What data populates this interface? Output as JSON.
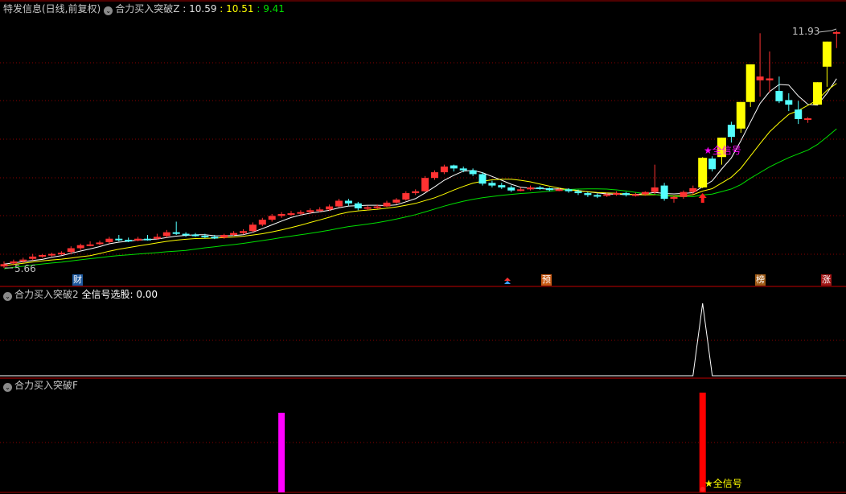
{
  "header": {
    "title": "特发信息(日线,前复权)",
    "indicator": "合力买入突破Z",
    "v1": ": 10.59",
    "v2": ": 10.51",
    "v3": ": 9.41"
  },
  "panel2": {
    "title": "合力买入突破2",
    "label": "全信号选股:",
    "value": "0.00"
  },
  "panel3": {
    "title": "合力买入突破F",
    "signal_label": "★全信号"
  },
  "main_chart": {
    "high_label": "11.93",
    "low_label": "5.66",
    "signal_label": "★全信号",
    "markers": [
      {
        "text": "财",
        "color": "#1e5aa0",
        "index": 7
      },
      {
        "text": "预",
        "color": "#c85a14",
        "index": 56
      },
      {
        "text": "榜",
        "color": "#a05a14",
        "index": 79
      },
      {
        "text": "涨",
        "color": "#a01414",
        "index": 86
      }
    ]
  },
  "colors": {
    "up": "#ff3232",
    "down": "#54ffff",
    "signal": "#ffff00",
    "ma5": "#ffffff",
    "ma10": "#ffff00",
    "ma20": "#00e000",
    "grid": "#8b0000",
    "magenta": "#ff00ff"
  },
  "chart_data": {
    "type": "candlestick",
    "price_range": [
      5.66,
      11.93
    ],
    "signal_candles": [
      73,
      75,
      77,
      78,
      85,
      86
    ],
    "candles_ohlc": [
      [
        5.72,
        5.85,
        5.68,
        5.78
      ],
      [
        5.8,
        5.9,
        5.75,
        5.85
      ],
      [
        5.88,
        5.95,
        5.82,
        5.9
      ],
      [
        5.92,
        6.05,
        5.88,
        5.98
      ],
      [
        6.0,
        6.05,
        5.95,
        6.02
      ],
      [
        6.03,
        6.08,
        5.98,
        6.05
      ],
      [
        6.05,
        6.12,
        6.02,
        6.08
      ],
      [
        6.1,
        6.25,
        6.05,
        6.2
      ],
      [
        6.2,
        6.32,
        6.15,
        6.28
      ],
      [
        6.28,
        6.38,
        6.25,
        6.3
      ],
      [
        6.32,
        6.4,
        6.28,
        6.35
      ],
      [
        6.36,
        6.5,
        6.32,
        6.45
      ],
      [
        6.45,
        6.55,
        6.38,
        6.42
      ],
      [
        6.42,
        6.48,
        6.36,
        6.4
      ],
      [
        6.4,
        6.5,
        6.38,
        6.45
      ],
      [
        6.45,
        6.55,
        6.4,
        6.44
      ],
      [
        6.45,
        6.58,
        6.42,
        6.5
      ],
      [
        6.52,
        6.68,
        6.48,
        6.62
      ],
      [
        6.62,
        6.9,
        6.55,
        6.58
      ],
      [
        6.58,
        6.62,
        6.5,
        6.55
      ],
      [
        6.56,
        6.6,
        6.5,
        6.53
      ],
      [
        6.53,
        6.58,
        6.46,
        6.5
      ],
      [
        6.5,
        6.55,
        6.44,
        6.48
      ],
      [
        6.48,
        6.58,
        6.45,
        6.55
      ],
      [
        6.55,
        6.65,
        6.52,
        6.6
      ],
      [
        6.6,
        6.7,
        6.56,
        6.65
      ],
      [
        6.65,
        6.88,
        6.62,
        6.82
      ],
      [
        6.82,
        7.0,
        6.78,
        6.95
      ],
      [
        6.95,
        7.1,
        6.9,
        7.05
      ],
      [
        7.05,
        7.15,
        7.0,
        7.1
      ],
      [
        7.1,
        7.18,
        7.05,
        7.12
      ],
      [
        7.12,
        7.2,
        7.08,
        7.15
      ],
      [
        7.15,
        7.25,
        7.1,
        7.2
      ],
      [
        7.2,
        7.28,
        7.15,
        7.22
      ],
      [
        7.22,
        7.35,
        7.18,
        7.3
      ],
      [
        7.3,
        7.5,
        7.28,
        7.45
      ],
      [
        7.45,
        7.5,
        7.32,
        7.38
      ],
      [
        7.38,
        7.42,
        7.2,
        7.25
      ],
      [
        7.25,
        7.32,
        7.2,
        7.28
      ],
      [
        7.28,
        7.35,
        7.24,
        7.3
      ],
      [
        7.3,
        7.45,
        7.28,
        7.4
      ],
      [
        7.4,
        7.52,
        7.36,
        7.48
      ],
      [
        7.48,
        7.7,
        7.45,
        7.65
      ],
      [
        7.65,
        7.75,
        7.6,
        7.7
      ],
      [
        7.7,
        8.1,
        7.68,
        8.05
      ],
      [
        8.05,
        8.25,
        8.0,
        8.2
      ],
      [
        8.2,
        8.4,
        8.15,
        8.35
      ],
      [
        8.38,
        8.4,
        8.22,
        8.3
      ],
      [
        8.3,
        8.35,
        8.2,
        8.25
      ],
      [
        8.25,
        8.3,
        8.1,
        8.15
      ],
      [
        8.15,
        8.2,
        7.85,
        7.9
      ],
      [
        7.92,
        7.98,
        7.8,
        7.85
      ],
      [
        7.86,
        7.92,
        7.76,
        7.8
      ],
      [
        7.8,
        7.85,
        7.68,
        7.72
      ],
      [
        7.72,
        7.8,
        7.7,
        7.75
      ],
      [
        7.75,
        7.85,
        7.72,
        7.8
      ],
      [
        7.8,
        7.84,
        7.74,
        7.78
      ],
      [
        7.78,
        7.8,
        7.7,
        7.73
      ],
      [
        7.73,
        7.78,
        7.7,
        7.75
      ],
      [
        7.75,
        7.78,
        7.66,
        7.7
      ],
      [
        7.7,
        7.74,
        7.6,
        7.65
      ],
      [
        7.65,
        7.68,
        7.55,
        7.6
      ],
      [
        7.6,
        7.64,
        7.52,
        7.58
      ],
      [
        7.58,
        7.66,
        7.55,
        7.62
      ],
      [
        7.62,
        7.7,
        7.58,
        7.65
      ],
      [
        7.65,
        7.68,
        7.56,
        7.6
      ],
      [
        7.6,
        7.66,
        7.56,
        7.62
      ],
      [
        7.62,
        7.7,
        7.58,
        7.68
      ],
      [
        7.68,
        8.4,
        7.62,
        7.8
      ],
      [
        7.85,
        7.92,
        7.45,
        7.5
      ],
      [
        7.5,
        7.58,
        7.4,
        7.55
      ],
      [
        7.55,
        7.72,
        7.5,
        7.68
      ],
      [
        7.68,
        7.85,
        7.62,
        7.78
      ],
      [
        7.8,
        8.6,
        7.78,
        8.58
      ],
      [
        8.56,
        8.62,
        8.22,
        8.28
      ],
      [
        8.6,
        9.11,
        8.4,
        9.11
      ],
      [
        9.45,
        9.53,
        8.98,
        9.13
      ],
      [
        9.35,
        10.05,
        9.24,
        10.05
      ],
      [
        10.05,
        11.04,
        9.92,
        11.04
      ],
      [
        10.62,
        11.86,
        10.19,
        10.72
      ],
      [
        10.62,
        11.38,
        10.3,
        10.67
      ],
      [
        10.34,
        10.72,
        10.02,
        10.07
      ],
      [
        10.1,
        10.28,
        9.81,
        9.98
      ],
      [
        9.85,
        10.08,
        9.47,
        9.6
      ],
      [
        9.58,
        9.65,
        9.5,
        9.62
      ],
      [
        9.98,
        10.57,
        9.98,
        10.57
      ],
      [
        10.98,
        11.64,
        10.45,
        11.64
      ],
      [
        11.85,
        11.93,
        11.47,
        11.89
      ]
    ],
    "moving_averages": [
      "MA5",
      "MA10",
      "MA20"
    ],
    "panel2_signal": {
      "index": 73,
      "value": 1
    },
    "panel3_bars": [
      {
        "index": 29,
        "color": "magenta"
      },
      {
        "index": 73,
        "color": "red"
      }
    ]
  }
}
